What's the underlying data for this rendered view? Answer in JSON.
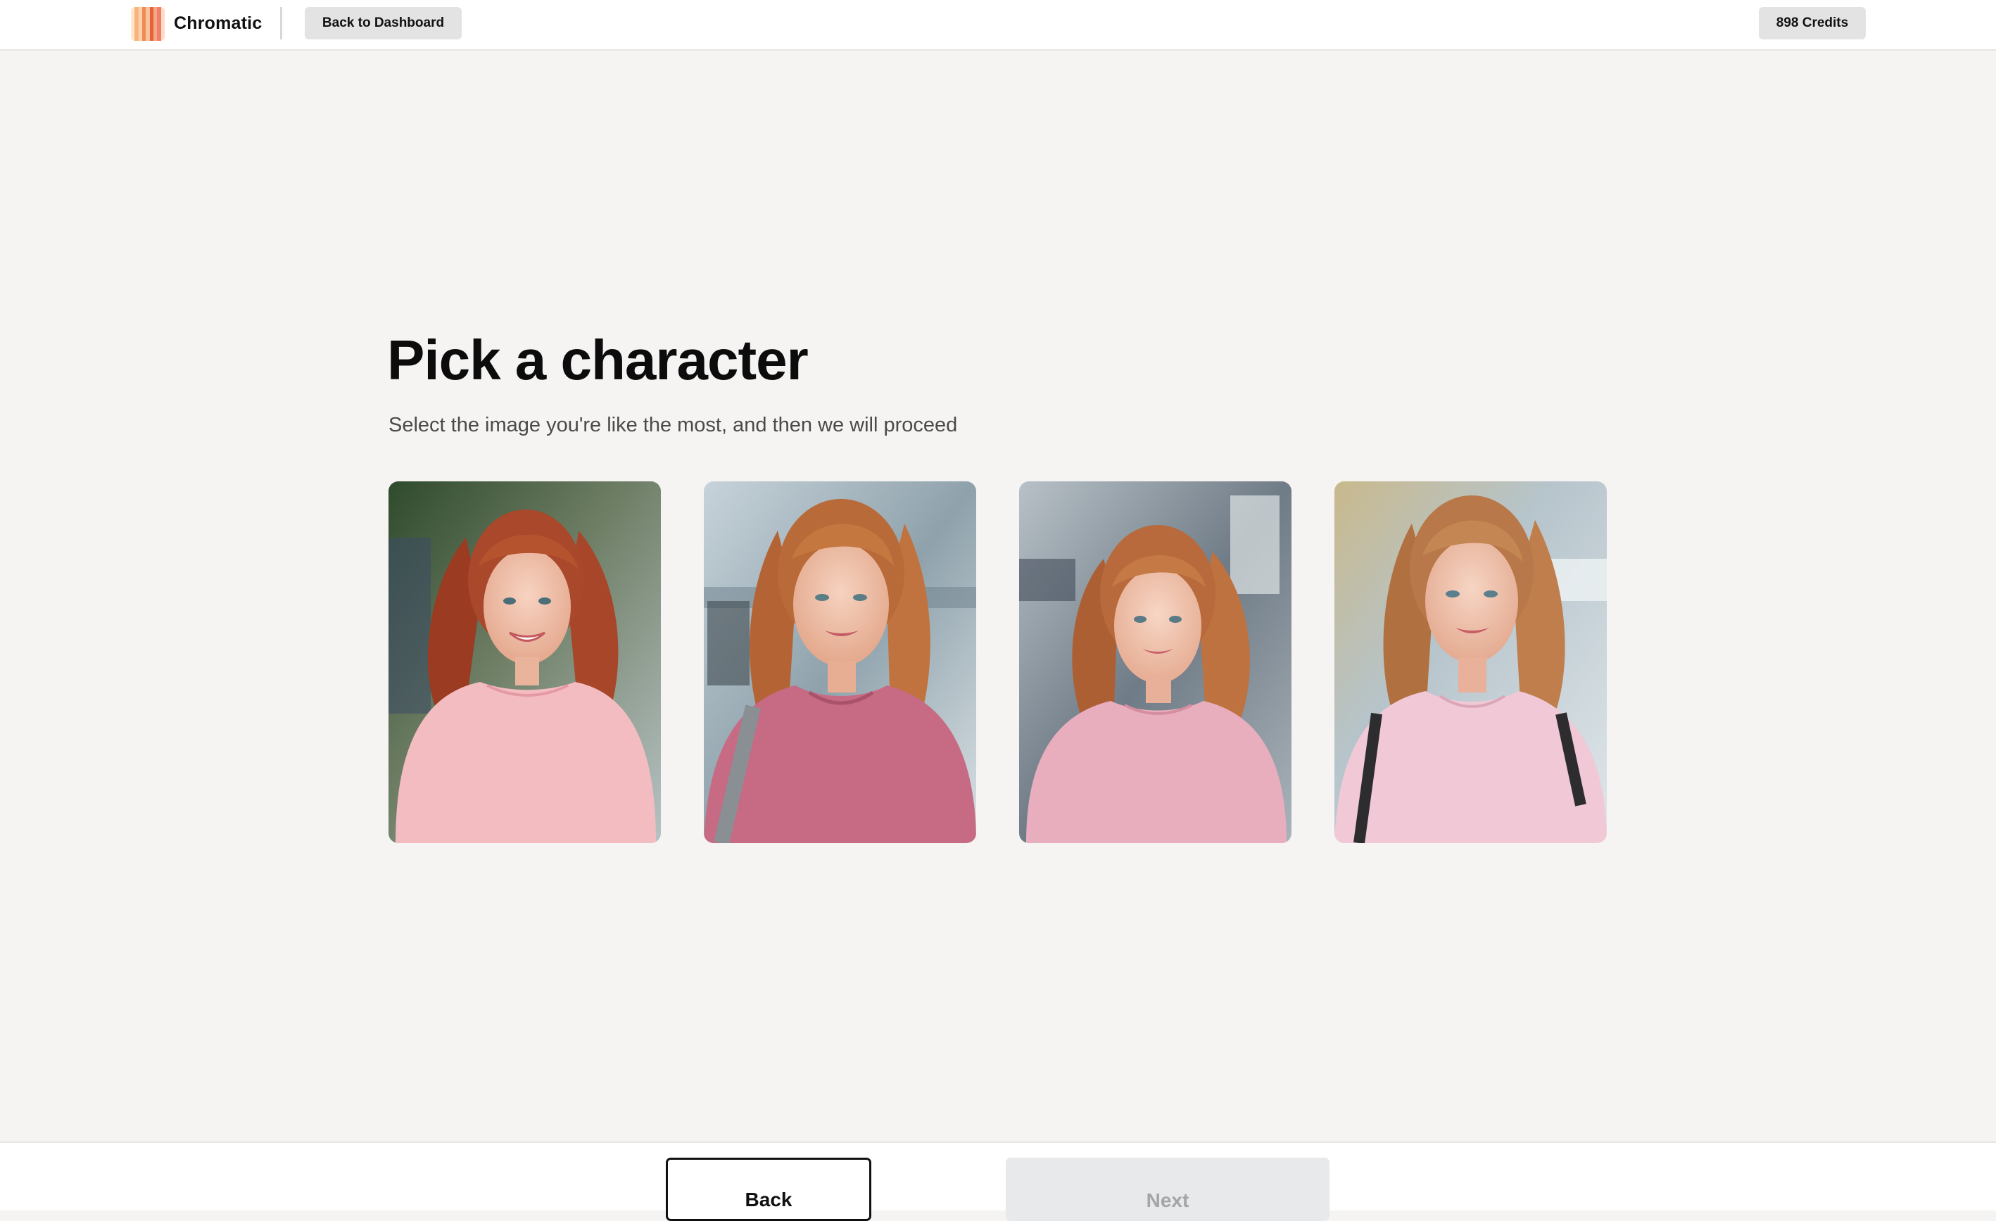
{
  "header": {
    "app_name": "Chromatic",
    "back_to_dashboard_label": "Back to Dashboard",
    "credits_label": "898 Credits"
  },
  "main": {
    "title": "Pick a character",
    "subtitle": "Select the image you're like the most, and then we will proceed",
    "characters": [
      {
        "alt": "Smiling red-haired woman in a light pink t-shirt outdoors",
        "shirt_color": "#f3bcc0",
        "hair_color": "#a9482a",
        "background_color": "#5d6b52"
      },
      {
        "alt": "Smiling red-haired woman in a dark pink t-shirt with a backpack strap",
        "shirt_color": "#c76a83",
        "hair_color": "#b86a38",
        "background_color": "#9fb0b8"
      },
      {
        "alt": "Smiling red-haired woman in a pink t-shirt by a harbor",
        "shirt_color": "#e9aebd",
        "hair_color": "#b86a3c",
        "background_color": "#8d98a3"
      },
      {
        "alt": "Smiling red-haired woman in a light pink t-shirt with backpack straps",
        "shirt_color": "#f1c8d6",
        "hair_color": "#b8784a",
        "background_color": "#b9c7cf"
      }
    ]
  },
  "footer": {
    "back_label": "Back",
    "next_label": "Next"
  },
  "colors": {
    "page_background": "#f5f4f2",
    "button_background": "#e3e3e3",
    "next_disabled_background": "#e8e9ea",
    "next_disabled_text": "#a3a5a8"
  },
  "icons": {
    "logo": "chromatic-logo-icon"
  }
}
